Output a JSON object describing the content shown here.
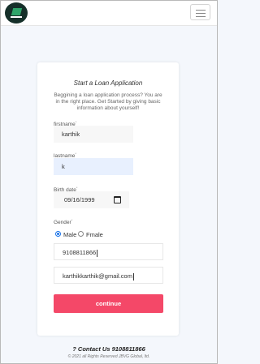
{
  "navbar": {
    "logo_icon": "company-logo",
    "menu_icon": "hamburger-menu-icon"
  },
  "card": {
    "title": "Start a Loan Application",
    "description": "Beggining a loan application process? You are in the right place. Get Started by giving basic information about yourself!"
  },
  "form": {
    "firstname": {
      "label": "firstname",
      "required_mark": "*",
      "value": "karthik"
    },
    "lastname": {
      "label": "lastname",
      "required_mark": "*",
      "value": "k"
    },
    "birth_date": {
      "label": "Birth date",
      "required_mark": "*",
      "value": "09/16/1999",
      "icon": "calendar-icon"
    },
    "gender": {
      "label": "Gender",
      "required_mark": "*",
      "options": [
        {
          "label": "Male",
          "checked": true
        },
        {
          "label": "Fmale",
          "checked": false
        }
      ]
    },
    "phone": {
      "value": "9108811866"
    },
    "email": {
      "value": "karthikkarthik@gmail.com"
    },
    "submit_label": "continue"
  },
  "footer": {
    "contact": "? Contact Us 9108811866",
    "copyright": "© 2021 all Rights Reserved JBVG Global, ltd."
  },
  "colors": {
    "accent_button": "#f44868",
    "autofill_background": "#e8f0fe",
    "page_background": "#f4f7fc",
    "radio_checked": "#1a73e8"
  }
}
